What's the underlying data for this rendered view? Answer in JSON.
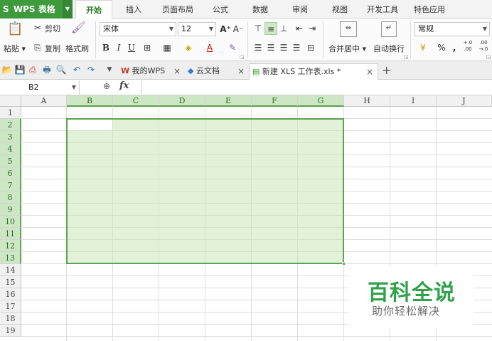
{
  "menubar": {
    "app_name": "WPS 表格",
    "app_logo": "S",
    "items": [
      "开始",
      "插入",
      "页面布局",
      "公式",
      "数据",
      "审阅",
      "视图",
      "开发工具",
      "特色应用"
    ],
    "active_index": 0
  },
  "ribbon": {
    "paste_label": "粘贴",
    "cut_label": "剪切",
    "copy_label": "复制",
    "format_painter_label": "格式刷",
    "font_name": "宋体",
    "font_size": "12",
    "bold": "B",
    "italic": "I",
    "underline": "U",
    "grow_font": "A⁺",
    "shrink_font": "A⁻",
    "font_color_glyph": "A",
    "merge_center_label": "合并居中",
    "wrap_text_label": "自动换行",
    "number_format": "常规",
    "percent": "%",
    "comma": ",",
    "inc_decimal": "+.0 .00",
    "dec_decimal": ".00 →.0"
  },
  "quickbar": {
    "tabs": [
      {
        "label": "我的WPS",
        "close": "×"
      },
      {
        "label": "云文档",
        "close": "×"
      },
      {
        "label": "新建 XLS 工作表.xls *",
        "close": "×"
      }
    ],
    "active_tab": 2,
    "add_tab": "+"
  },
  "formulabar": {
    "cell_ref": "B2",
    "fx_label": "fx",
    "formula": ""
  },
  "grid": {
    "columns": [
      "A",
      "B",
      "C",
      "D",
      "E",
      "F",
      "G",
      "H",
      "I",
      "J"
    ],
    "rows": [
      "1",
      "2",
      "3",
      "4",
      "5",
      "6",
      "7",
      "8",
      "9",
      "10",
      "11",
      "12",
      "13",
      "14",
      "15",
      "16",
      "17",
      "18",
      "19"
    ],
    "selected_range": "B2:G13",
    "active_cell": "B2"
  },
  "watermark": {
    "title": "百科全说",
    "subtitle": "助你轻松解决"
  },
  "colors": {
    "accent": "#3f9a3c",
    "selection_fill": "#e2f2d9",
    "selection_border": "#5aa350",
    "header_selected": "#cde6c4",
    "watermark_green": "#2fa24a"
  }
}
